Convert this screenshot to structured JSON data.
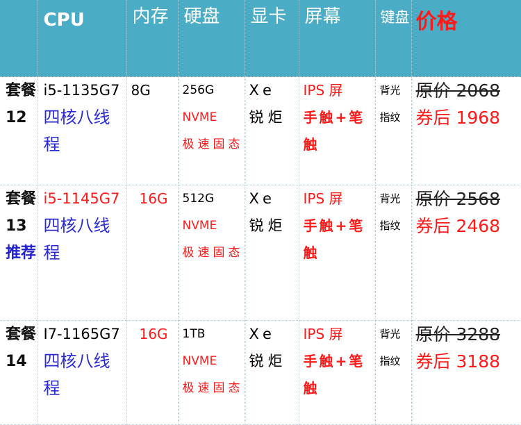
{
  "headers": {
    "package": "",
    "cpu": "CPU",
    "memory": "内存",
    "disk": "硬盘",
    "gpu": "显卡",
    "screen": "屏幕",
    "keyboard": "键盘",
    "price": "价格"
  },
  "rows": [
    {
      "package_prefix": "套餐",
      "package_no": "12",
      "recommend": "",
      "cpu_model": "i5-1135G7",
      "cpu_desc": "四核八线程",
      "memory": "8G",
      "memory_red": false,
      "disk_size": "256G",
      "disk_type": "NVME",
      "disk_desc": "极速固态",
      "gpu": "Xe 锐炬",
      "screen_line1": "IPS 屏",
      "screen_line2": "手触+笔触",
      "keyboard_line1": "背光",
      "keyboard_line2": "指纹",
      "price_orig": "原价 2068",
      "price_after": "券后 1968"
    },
    {
      "package_prefix": "套餐",
      "package_no": "13",
      "recommend": "推荐",
      "cpu_model": "i5-1145G7",
      "cpu_desc": "四核八线程",
      "memory": "16G",
      "memory_red": true,
      "disk_size": "512G",
      "disk_type": "NVME",
      "disk_desc": "极速固态",
      "gpu": "Xe 锐炬",
      "screen_line1": "IPS 屏",
      "screen_line2": "手触+笔触",
      "keyboard_line1": "背光",
      "keyboard_line2": "指纹",
      "price_orig": "原价 2568",
      "price_after": "券后 2468"
    },
    {
      "package_prefix": "套餐",
      "package_no": "14",
      "recommend": "",
      "cpu_model": "I7-1165G7",
      "cpu_desc": "四核八线程",
      "memory": "16G",
      "memory_red": true,
      "disk_size": "1TB",
      "disk_type": "NVME",
      "disk_desc": "极速固态",
      "gpu": "Xe 锐炬",
      "screen_line1": "IPS 屏",
      "screen_line2": "手触+笔触",
      "keyboard_line1": "背光",
      "keyboard_line2": "指纹",
      "price_orig": "原价 3288",
      "price_after": "券后 3188"
    }
  ],
  "colors": {
    "header_bg": "#4bacc6",
    "header_text": "#ffffff",
    "accent_red": "#ff1a1a",
    "accent_blue": "#2a2ad0"
  }
}
